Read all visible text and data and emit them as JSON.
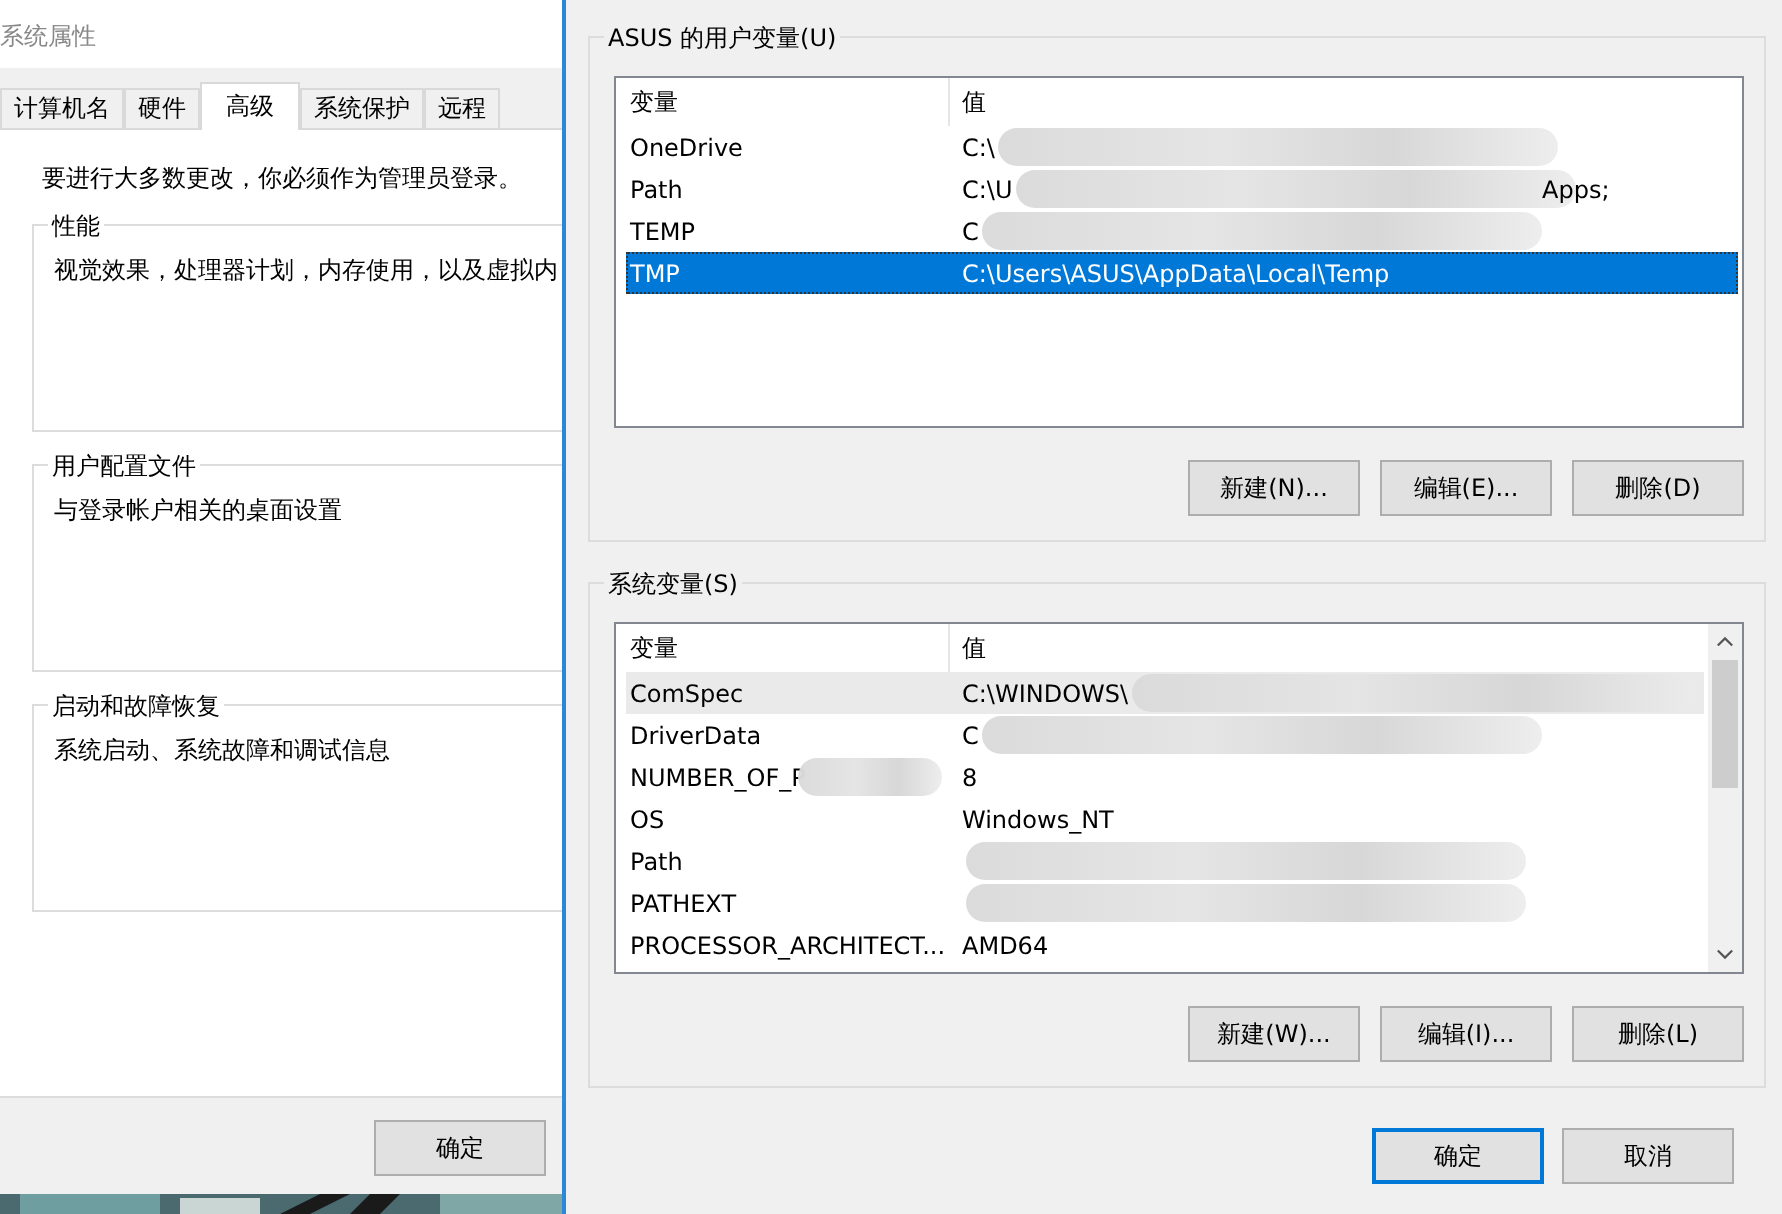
{
  "left_window": {
    "title": "系统属性",
    "tabs": [
      {
        "label": "计算机名",
        "selected": false
      },
      {
        "label": "硬件",
        "selected": false
      },
      {
        "label": "高级",
        "selected": true
      },
      {
        "label": "系统保护",
        "selected": false
      },
      {
        "label": "远程",
        "selected": false
      }
    ],
    "notice": "要进行大多数更改，你必须作为管理员登录。",
    "groups": [
      {
        "title": "性能",
        "description": "视觉效果，处理器计划，内存使用，以及虚拟内"
      },
      {
        "title": "用户配置文件",
        "description": "与登录帐户相关的桌面设置"
      },
      {
        "title": "启动和故障恢复",
        "description": "系统启动、系统故障和调试信息"
      }
    ],
    "ok_button": "确定"
  },
  "env_window": {
    "sections": [
      {
        "title": "ASUS 的用户变量(U)",
        "columns": [
          "变量",
          "值"
        ],
        "scrollbar": false,
        "rows": [
          {
            "name": "OneDrive",
            "value": "C:\\",
            "redacted": true,
            "selected": false,
            "highlighted": false
          },
          {
            "name": "Path",
            "value": "C:\\U",
            "value_tail": "Apps;",
            "redacted": true,
            "selected": false,
            "highlighted": false
          },
          {
            "name": "TEMP",
            "value": "C",
            "redacted": true,
            "selected": false,
            "highlighted": false
          },
          {
            "name": "TMP",
            "value": "C:\\Users\\ASUS\\AppData\\Local\\Temp",
            "redacted": false,
            "selected": true,
            "highlighted": false
          }
        ],
        "buttons": [
          "新建(N)...",
          "编辑(E)...",
          "删除(D)"
        ]
      },
      {
        "title": "系统变量(S)",
        "columns": [
          "变量",
          "值"
        ],
        "scrollbar": true,
        "rows": [
          {
            "name": "ComSpec",
            "value": "C:\\WINDOWS\\",
            "redacted": true,
            "selected": false,
            "highlighted": true
          },
          {
            "name": "DriverData",
            "value": "C",
            "redacted": true,
            "selected": false,
            "highlighted": false
          },
          {
            "name": "NUMBER_OF_P",
            "value": "8",
            "redacted": false,
            "name_redacted": true,
            "selected": false,
            "highlighted": false
          },
          {
            "name": "OS",
            "value": "Windows_NT",
            "redacted": false,
            "selected": false,
            "highlighted": false
          },
          {
            "name": "Path",
            "value": "",
            "redacted": true,
            "selected": false,
            "highlighted": false
          },
          {
            "name": "PATHEXT",
            "value": "",
            "redacted": true,
            "selected": false,
            "highlighted": false
          },
          {
            "name": "PROCESSOR_ARCHITECT...",
            "value": "AMD64",
            "redacted": false,
            "selected": false,
            "highlighted": false
          }
        ],
        "buttons": [
          "新建(W)...",
          "编辑(I)...",
          "删除(L)"
        ]
      }
    ],
    "ok_button": "确定",
    "cancel_button": "取消"
  }
}
